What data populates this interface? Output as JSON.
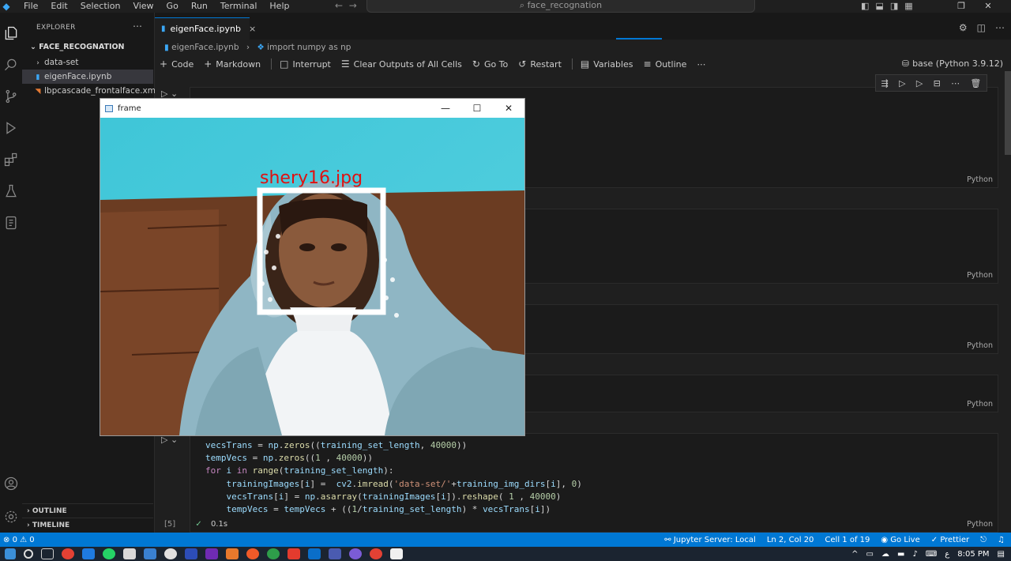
{
  "titlebar": {
    "menus": [
      "File",
      "Edit",
      "Selection",
      "View",
      "Go",
      "Run",
      "Terminal",
      "Help"
    ],
    "search": "face_recognation"
  },
  "sidebar": {
    "header": "EXPLORER",
    "folder": "FACE_RECOGNATION",
    "items": [
      {
        "label": "data-set",
        "icon": "chevron-right-icon"
      },
      {
        "label": "eigenFace.ipynb",
        "icon": "notebook-icon"
      },
      {
        "label": "lbpcascade_frontalface.xml",
        "icon": "xml-icon"
      }
    ],
    "outline": "OUTLINE",
    "timeline": "TIMELINE"
  },
  "editor": {
    "tab": "eigenFace.ipynb",
    "breadcrumb": [
      "eigenFace.ipynb",
      "import numpy as np"
    ],
    "toolbar": {
      "code": "Code",
      "markdown": "Markdown",
      "interrupt": "Interrupt",
      "clear": "Clear Outputs of All Cells",
      "goto": "Go To",
      "restart": "Restart",
      "variables": "Variables",
      "outline": "Outline"
    },
    "kernel": "base (Python 3.9.12)",
    "cell_lang": "Python",
    "exec_count": "[5]",
    "exec_time": "0.1s"
  },
  "frame_window": {
    "title": "frame",
    "label": "shery16.jpg"
  },
  "statusbar": {
    "errors": "0",
    "warnings": "0",
    "jupyter": "Jupyter Server: Local",
    "position": "Ln 2, Col 20",
    "cell": "Cell 1 of 19",
    "golive": "Go Live",
    "prettier": "Prettier"
  },
  "taskbar": {
    "time": "8:05 PM"
  },
  "colors": {
    "accent": "#0078d4",
    "status_bg": "#0078d4",
    "label_red": "#e01010"
  }
}
